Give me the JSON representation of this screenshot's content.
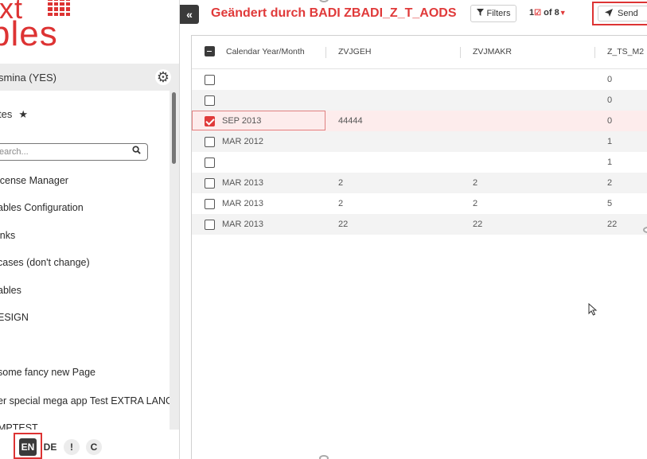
{
  "sidebar": {
    "logo_line1": "ext",
    "logo_line2": "bles",
    "user_name": "smina (YES)",
    "favorites": "tes",
    "search_placeholder": "earch...",
    "nav_items": [
      {
        "label": "icense Manager"
      },
      {
        "label": "ables Configuration"
      },
      {
        "label": "inks"
      },
      {
        "label": "cases (don't change)"
      },
      {
        "label": "ables"
      },
      {
        "label": "ESIGN"
      },
      {
        "label": "some fancy new Page"
      },
      {
        "label": "er special mega app Test EXTRA LANG..."
      },
      {
        "label": "MPTEST"
      }
    ],
    "languages": {
      "en": "EN",
      "de": "DE"
    },
    "bottom_icons": {
      "exclamation": "!",
      "c": "C"
    }
  },
  "toolbar": {
    "title": "Geändert durch BADI ZBADI_Z_T_AODS",
    "filters_label": "Filters",
    "count_prefix": "1",
    "count_suffix": "of 8",
    "send_label": "Send"
  },
  "table": {
    "columns": [
      "Calendar Year/Month",
      "ZVJGEH",
      "ZVJMAKR",
      "Z_TS_M2"
    ],
    "rows": [
      {
        "checked": false,
        "cells": [
          "",
          "",
          "",
          "0"
        ]
      },
      {
        "checked": false,
        "cells": [
          "",
          "",
          "",
          "0"
        ]
      },
      {
        "checked": true,
        "cells": [
          "SEP 2013",
          "44444",
          "",
          "0"
        ]
      },
      {
        "checked": false,
        "cells": [
          "MAR 2012",
          "",
          "",
          "1"
        ]
      },
      {
        "checked": false,
        "cells": [
          "",
          "",
          "",
          "1"
        ]
      },
      {
        "checked": false,
        "cells": [
          "MAR 2013",
          "2",
          "2",
          "2"
        ]
      },
      {
        "checked": false,
        "cells": [
          "MAR 2013",
          "2",
          "2",
          "5"
        ]
      },
      {
        "checked": false,
        "cells": [
          "MAR 2013",
          "22",
          "22",
          "22"
        ]
      }
    ]
  },
  "colors": {
    "accent": "#e03a3a",
    "dark": "#3a3a3a",
    "selected_row": "#fdecec"
  },
  "icons": [
    "gear-icon",
    "star-icon",
    "search-icon",
    "collapse-icon",
    "filter-icon",
    "send-icon",
    "mouse-cursor-icon"
  ]
}
